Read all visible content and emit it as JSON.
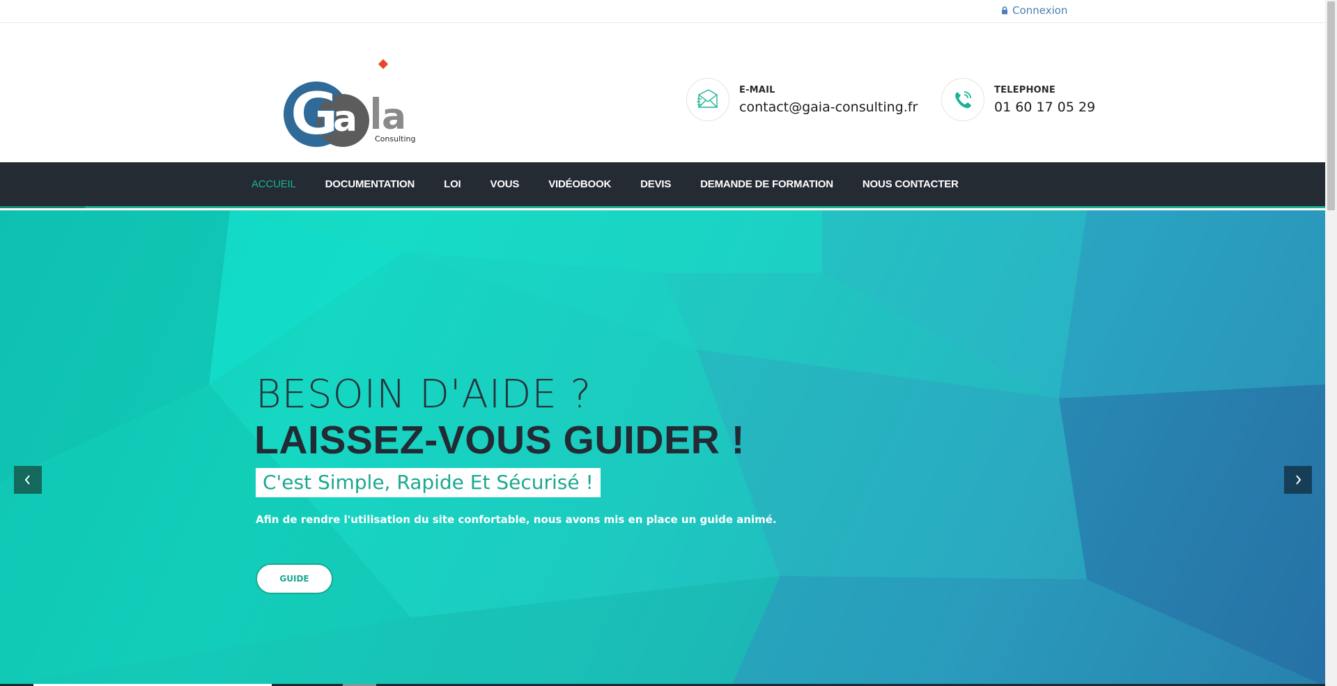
{
  "topbar": {
    "login_label": "Connexion"
  },
  "header": {
    "logo": {
      "letters": "Gaia",
      "tagline": "Consulting"
    },
    "email": {
      "label": "E-MAIL",
      "value": "contact@gaia-consulting.fr"
    },
    "phone": {
      "label": "TELEPHONE",
      "value": "01 60 17 05 29"
    }
  },
  "nav": {
    "items": [
      {
        "label": "ACCUEIL",
        "active": true
      },
      {
        "label": "DOCUMENTATION",
        "active": false
      },
      {
        "label": "LOI",
        "active": false
      },
      {
        "label": "VOUS",
        "active": false
      },
      {
        "label": "VIDÉOBOOK",
        "active": false
      },
      {
        "label": "DEVIS",
        "active": false
      },
      {
        "label": "DEMANDE DE FORMATION",
        "active": false
      },
      {
        "label": "NOUS CONTACTER",
        "active": false
      }
    ]
  },
  "hero": {
    "title_line1": "BESOIN D'AIDE ?",
    "title_line2": "LAISSEZ-VOUS GUIDER !",
    "highlight": "C'est Simple, Rapide Et Sécurisé !",
    "description": "Afin de rendre l'utilisation du site confortable, nous avons mis en place un guide animé.",
    "button_label": "GUIDE"
  },
  "colors": {
    "accent": "#19b394",
    "nav_bg": "#252b33",
    "link": "#4a7fb3",
    "logo_blue": "#2f6a98",
    "logo_gray": "#5a5a5a",
    "logo_red": "#e8452a"
  },
  "icons": {
    "login": "lock-icon",
    "email": "envelope-icon",
    "phone": "phone-icon",
    "prev": "chevron-left-icon",
    "next": "chevron-right-icon"
  }
}
